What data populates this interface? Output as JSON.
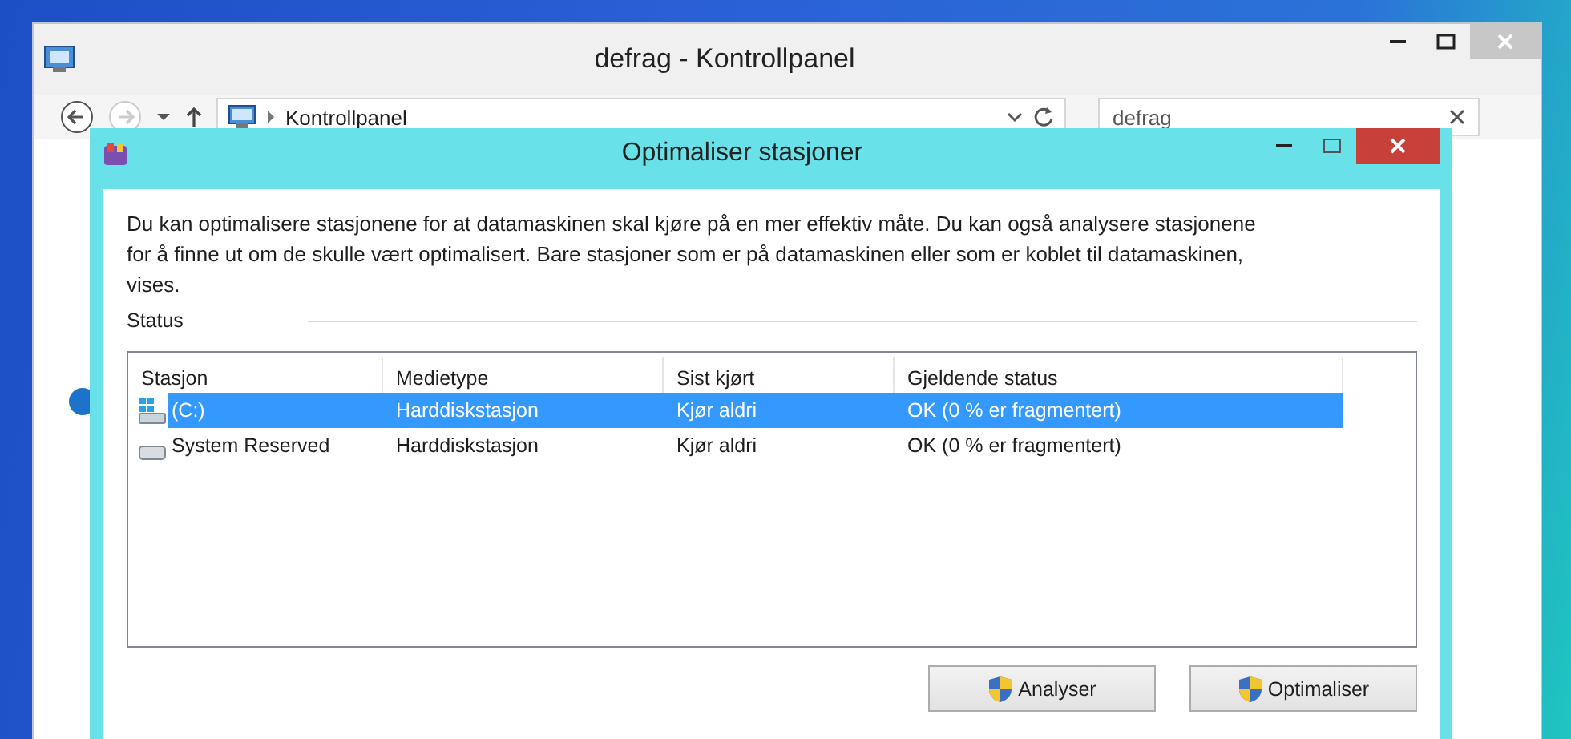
{
  "window": {
    "title": "defrag - Kontrollpanel",
    "address": "Kontrollpanel",
    "search": "defrag"
  },
  "dialog": {
    "title": "Optimaliser stasjoner",
    "description": "Du kan optimalisere stasjonene for at datamaskinen skal kjøre på en mer effektiv måte. Du kan også analysere stasjonene for å finne ut om de skulle vært optimalisert. Bare stasjoner som er på datamaskinen eller som er koblet til datamaskinen, vises.",
    "status_label": "Status",
    "columns": [
      "Stasjon",
      "Medietype",
      "Sist kjørt",
      "Gjeldende status"
    ],
    "rows": [
      {
        "kind": "system",
        "drive": "(C:)",
        "media": "Harddiskstasjon",
        "last_run": "Kjør aldri",
        "status": "OK (0 % er fragmentert)",
        "selected": true
      },
      {
        "kind": "drive",
        "drive": "System Reserved",
        "media": "Harddiskstasjon",
        "last_run": "Kjør aldri",
        "status": "OK (0 % er fragmentert)",
        "selected": false
      }
    ],
    "buttons": [
      "Analyser",
      "Optimaliser"
    ]
  }
}
